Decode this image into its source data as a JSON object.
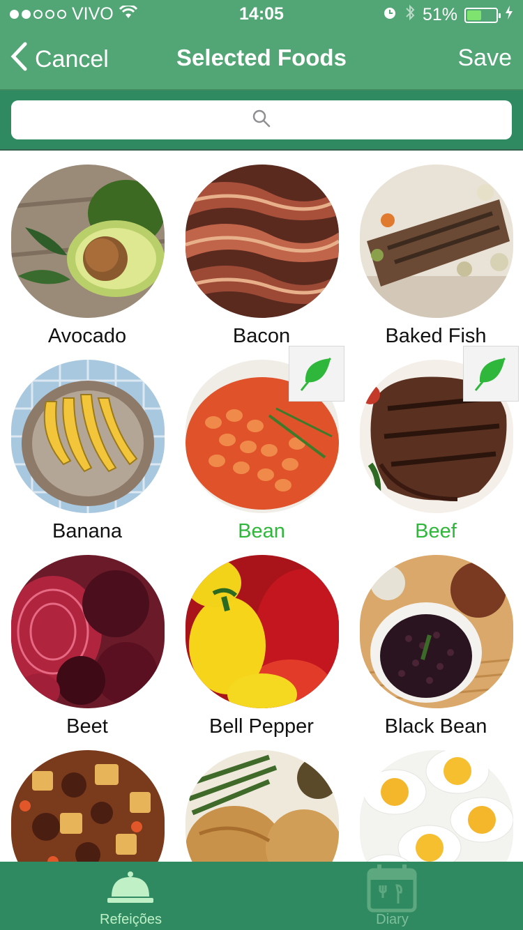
{
  "status": {
    "carrier": "VIVO",
    "time": "14:05",
    "battery_percent": "51%",
    "battery_level": 0.51,
    "signal_dots": [
      true,
      true,
      false,
      false,
      false
    ]
  },
  "nav": {
    "cancel_label": "Cancel",
    "title": "Selected Foods",
    "save_label": "Save"
  },
  "search": {
    "placeholder": ""
  },
  "colors": {
    "primary": "#52a574",
    "secondary": "#2f8a62",
    "selected_text": "#2eb73a"
  },
  "foods": [
    {
      "name": "Avocado",
      "selected": false
    },
    {
      "name": "Bacon",
      "selected": false
    },
    {
      "name": "Baked Fish",
      "selected": false
    },
    {
      "name": "Banana",
      "selected": false
    },
    {
      "name": "Bean",
      "selected": true
    },
    {
      "name": "Beef",
      "selected": true
    },
    {
      "name": "Beet",
      "selected": false
    },
    {
      "name": "Bell Pepper",
      "selected": false
    },
    {
      "name": "Black Bean",
      "selected": false
    },
    {
      "name": "",
      "selected": false
    },
    {
      "name": "",
      "selected": false
    },
    {
      "name": "",
      "selected": false
    }
  ],
  "tabs": [
    {
      "label": "Refeições",
      "icon": "cloche-icon",
      "active": true
    },
    {
      "label": "Diary",
      "icon": "calendar-icon",
      "active": false
    }
  ]
}
